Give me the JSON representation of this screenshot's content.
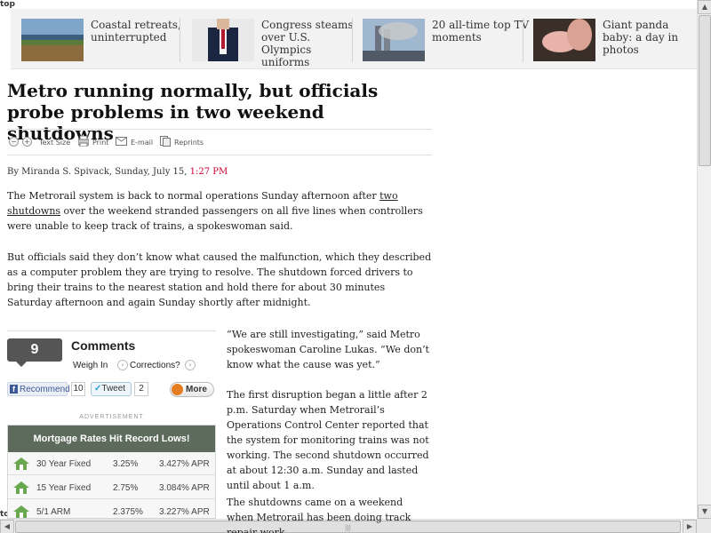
{
  "window": {
    "top_label": "top",
    "bottom_label": "top"
  },
  "promos": [
    {
      "caption": "Coastal retreats, uninterrupted",
      "image": "coastal-landscape-photo"
    },
    {
      "caption": "Congress steams over U.S. Olympics uniforms",
      "image": "olympic-uniform-photo"
    },
    {
      "caption": "20 all-time top TV moments",
      "image": "city-skyline-smoke-photo"
    },
    {
      "caption": "Giant panda baby: a day in photos",
      "image": "panda-baby-photo"
    }
  ],
  "article": {
    "headline": "Metro running normally, but officials probe problems in two weekend shutdowns",
    "byline_author": "By Miranda S. Spivack, Sunday, July 15,",
    "byline_time": "1:27 PM",
    "p1_before_link": "The Metrorail system is back to normal operations Sunday afternoon after ",
    "p1_link": "two shutdowns",
    "p1_after_link": " over the weekend stranded passengers on all five lines when controllers were unable to keep track of trains, a spokeswoman said.",
    "p2": "But officials said they don’t know what caused the malfunction, which they described as a computer problem they are trying to resolve. The shutdown forced drivers to bring their trains to the nearest station and hold there for about 30 minutes Saturday afternoon and again Sunday shortly after midnight.",
    "p3": "“We are still investigating,” said Metro spokeswoman Caroline Lukas. “We don’t know what the cause was yet.”",
    "p4": "The first disruption began a little after 2 p.m. Saturday when Metrorail’s Operations Control Center reported that the system for monitoring trains was not working. The second shutdown occurred at about 12:30 a.m. Sunday and lasted until about 1 a.m.",
    "p5": "The shutdowns came on a weekend when Metrorail has been doing track repair work"
  },
  "tools": {
    "decrease": "−",
    "increase": "+",
    "text_size": "Text Size",
    "print": "Print",
    "email": "E-mail",
    "reprints": "Reprints"
  },
  "comments": {
    "count": "9",
    "title": "Comments",
    "weigh_in": "Weigh In",
    "corrections": "Corrections?"
  },
  "social": {
    "fb_icon_letter": "f",
    "recommend": "Recommend",
    "recommend_count": "10",
    "tweet": "Tweet",
    "tweet_count": "2",
    "more": "More"
  },
  "ad": {
    "label": "ADVERTISEMENT",
    "title": "Mortgage Rates Hit Record Lows!",
    "rows": [
      {
        "product": "30 Year Fixed",
        "rate": "3.25%",
        "apr": "3.427% APR"
      },
      {
        "product": "15 Year Fixed",
        "rate": "2.75%",
        "apr": "3.084% APR"
      },
      {
        "product": "5/1 ARM",
        "rate": "2.375%",
        "apr": "3.227% APR"
      }
    ]
  },
  "colors": {
    "time_red": "#cc0033",
    "ad_header": "#5d6b5c"
  }
}
